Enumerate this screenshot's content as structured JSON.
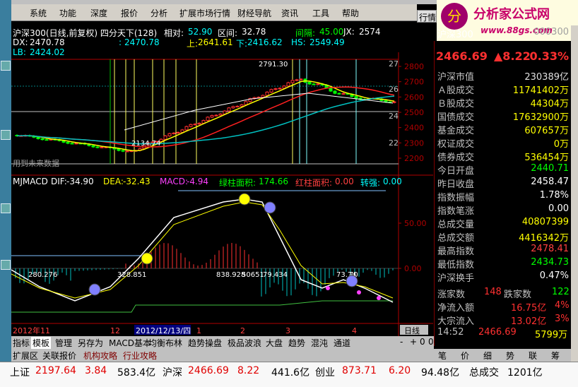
{
  "menu": [
    "系统",
    "功能",
    "深度",
    "报价",
    "分析",
    "扩展市场行情",
    "财经导航",
    "资讯",
    "工具",
    "帮助"
  ],
  "menu_right": "行情",
  "logo": {
    "title": "分析家公式网",
    "url": "www.88gs.com"
  },
  "chart_header": {
    "title": "沪深300(日线,前复权) 四分天下(128)",
    "xiang_dui_label": "相对:",
    "xiang_dui": "52.90",
    "qu_jian_label": "区间:",
    "qu_jian": "32.78",
    "jian_ge_label": "间隔:",
    "jian_ge": "45.00",
    "jx_label": "JX:",
    "jx": "2574"
  },
  "chart_row2": {
    "dx_label": "DX:",
    "dx": "2470.78",
    "tmp_label": ":",
    "tmp": "2470.78",
    "shang_label": "上:",
    "shang": "2641.61",
    "xia_label": "下:",
    "xia": "2416.62",
    "hs_label": "HS:",
    "hs": "2549.49"
  },
  "chart_row3": {
    "lb_label": "LB:",
    "lb": "2424.02"
  },
  "price_axis": [
    "2800",
    "2700",
    "2600",
    "2500",
    "2400",
    "2300",
    "2200"
  ],
  "right_small_axis": [
    "27",
    "26",
    "24",
    "22"
  ],
  "macd_axis": [
    "50.00",
    "0.00"
  ],
  "price_annotations": {
    "high": "2791.30",
    "low": "2134.74"
  },
  "future_note": "用到未来数据",
  "macd_header": {
    "name": "MJMACD",
    "dif_label": "DIF:",
    "dif": "-34.90",
    "dea_label": "DEA:",
    "dea": "-32.43",
    "macd_label": "MACD:",
    "macd": "-4.94",
    "green_label": "绿柱面积:",
    "green": "174.66",
    "red_label": "红柱面积:",
    "red": "0.00",
    "zq_label": "转强:",
    "zq": "0.00"
  },
  "macd_annotations": [
    "280.276",
    "328.851",
    "838.928",
    "50651",
    "79.434",
    "73.74",
    "70"
  ],
  "time_axis": {
    "y2012_11": "2012年11",
    "m12": "12",
    "date_hl": "2012/12/13/四",
    "m1": "1",
    "m2": "2",
    "m3": "3",
    "m4": "4",
    "period": "日线"
  },
  "bottom_tabs": [
    "指标",
    "模板",
    "管理",
    "另存为",
    "MACD基本",
    "均衡布林",
    "趋势操盘",
    "极品波浪",
    "大盘",
    "趋势",
    "混沌",
    "通道"
  ],
  "bottom_nav": [
    "-",
    "+",
    "0",
    "0"
  ],
  "tabs2": [
    "扩展区",
    "关联报价",
    "机构攻略",
    "行业攻略"
  ],
  "side": {
    "index_name": "沪深300",
    "index_code": "000300",
    "price": "2466.69",
    "change": "▲8.22",
    "pct": "0.33%",
    "rows": [
      {
        "l": "沪深市值",
        "v": "230389亿",
        "c": "#e0e0e0"
      },
      {
        "l": "Ａ股成交",
        "v": "11741402万",
        "c": "#ffff00"
      },
      {
        "l": "Ｂ股成交",
        "v": "44304万",
        "c": "#ffff00"
      },
      {
        "l": "国债成交",
        "v": "17632900万",
        "c": "#ffff00"
      },
      {
        "l": "基金成交",
        "v": "607657万",
        "c": "#ffff00"
      },
      {
        "l": "权证成交",
        "v": "0万",
        "c": "#ffff00"
      },
      {
        "l": "债券成交",
        "v": "536454万",
        "c": "#ffff00"
      },
      {
        "l": "今日开盘",
        "v": "2440.71",
        "c": "#00ff00"
      },
      {
        "l": "昨日收盘",
        "v": "2458.47",
        "c": "#ffffff"
      },
      {
        "l": "指数振幅",
        "v": "1.78%",
        "c": "#ffffff"
      },
      {
        "l": "指数笔涨",
        "v": "0.00",
        "c": "#ffffff"
      },
      {
        "l": "总成交量",
        "v": "40807399",
        "c": "#ffff00"
      },
      {
        "l": "总成交额",
        "v": "4416342万",
        "c": "#ffff00"
      },
      {
        "l": "最高指数",
        "v": "2478.41",
        "c": "#ff4040"
      },
      {
        "l": "最低指数",
        "v": "2434.73",
        "c": "#00ff00"
      },
      {
        "l": "沪深换手",
        "v": "0.47%",
        "c": "#ffffff"
      }
    ],
    "updown": {
      "up_label": "涨家数",
      "up": "148",
      "down_label": "跌家数",
      "down": "122"
    },
    "flow": [
      {
        "l": "净流入额",
        "v": "16.75亿",
        "p": "4%"
      },
      {
        "l": "大宗流入",
        "v": "13.02亿",
        "p": "3%"
      }
    ],
    "time": "14:52",
    "time_price": "2466.69",
    "time_vol": "5799万",
    "tabs": [
      "笔",
      "价",
      "细",
      "势",
      "联",
      "筹"
    ]
  },
  "status": {
    "sh_name": "上证",
    "sh_val": "2197.64",
    "sh_chg": "3.84",
    "sh_amt": "583.4亿",
    "hs_name": "沪深",
    "hs_val": "2466.69",
    "hs_chg": "8.22",
    "hs_amt": "441.6亿",
    "cy_name": "创业",
    "cy_val": "873.71",
    "cy_chg": "6.20",
    "cy_amt": "94.48亿",
    "tot_label": "总成交",
    "tot_val": "1201亿"
  },
  "colors": {
    "up": "#ff3030",
    "down": "#00ff00",
    "dif": "#ffffff",
    "dea": "#ffff00",
    "ma_yellow": "#ffff00",
    "ma_red": "#ff2020",
    "ma_cyan": "#00c0c0"
  }
}
